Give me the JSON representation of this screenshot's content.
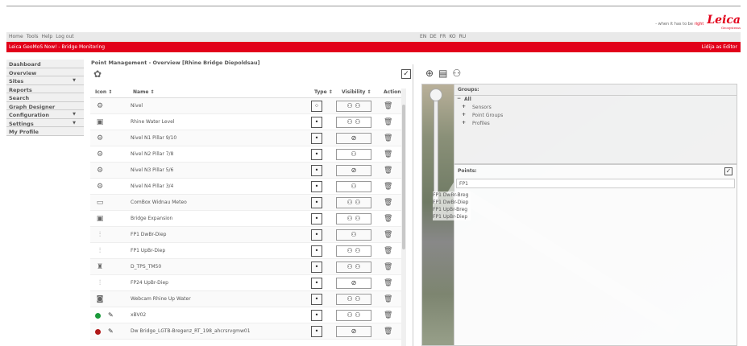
{
  "brand": {
    "tagline_prefix": "- when it has to be",
    "tagline_word": "right",
    "logo": "Leica",
    "logo_sub": "Geosystems"
  },
  "menu": {
    "items": [
      "Home",
      "Tools",
      "Help",
      "Log out"
    ],
    "languages": [
      "EN",
      "DE",
      "FR",
      "KO",
      "RU"
    ]
  },
  "app_bar": {
    "title": "Leica GeoMoS Now! - Bridge Monitoring",
    "user": "Lidija as Editor"
  },
  "sidebar": {
    "items": [
      {
        "label": "Dashboard",
        "arrow": ""
      },
      {
        "label": "Overview",
        "arrow": ""
      },
      {
        "label": "Sites",
        "arrow": "▼"
      },
      {
        "label": "Reports",
        "arrow": ""
      },
      {
        "label": "Search",
        "arrow": ""
      },
      {
        "label": "Graph Designer",
        "arrow": ""
      },
      {
        "label": "Configuration",
        "arrow": "▼"
      },
      {
        "label": "Settings",
        "arrow": "▼"
      },
      {
        "label": "My Profile",
        "arrow": ""
      }
    ]
  },
  "main": {
    "title": "Point Management - Overview [Rhine Bridge Diepoldsau]",
    "columns": {
      "icon": "Icon ⇕",
      "name": "Name ⇕",
      "type": "Type ⇕",
      "visibility": "Visibility ⇕",
      "action": "Action"
    },
    "rows": [
      {
        "icon": "gear-icon",
        "name": "Nivel",
        "type": "⁘",
        "visibility": "person-pair"
      },
      {
        "icon": "sensor-icon",
        "name": "Rhine Water Level",
        "type": "•",
        "visibility": "person-pair"
      },
      {
        "icon": "gear-icon",
        "name": "Nivel N1 Pillar 9/10",
        "type": "•",
        "visibility": "hidden"
      },
      {
        "icon": "gear-icon",
        "name": "Nivel N2 Pillar 7/8",
        "type": "•",
        "visibility": "person-single"
      },
      {
        "icon": "gear-icon",
        "name": "Nivel N3 Pillar 5/6",
        "type": "•",
        "visibility": "hidden"
      },
      {
        "icon": "gear-icon",
        "name": "Nivel N4 Pillar 3/4",
        "type": "•",
        "visibility": "person-single"
      },
      {
        "icon": "box-icon",
        "name": "ComBox Widnau Meteo",
        "type": "•",
        "visibility": "person-pair"
      },
      {
        "icon": "sensor-icon",
        "name": "Bridge Expansion",
        "type": "•",
        "visibility": "person-pair"
      },
      {
        "icon": "prism-icon",
        "name": "FP1 DwBr-Diep",
        "type": "•",
        "visibility": "person-single"
      },
      {
        "icon": "prism-icon",
        "name": "FP1 UpBr-Diep",
        "type": "•",
        "visibility": "person-pair"
      },
      {
        "icon": "total-station-icon",
        "name": "D_TPS_TM50",
        "type": "•",
        "visibility": "person-pair"
      },
      {
        "icon": "prism-icon",
        "name": "FP24 UpBr-Diep",
        "type": "•",
        "visibility": "hidden"
      },
      {
        "icon": "webcam-icon",
        "name": "Webcam Rhine Up Water",
        "type": "•",
        "visibility": "person-pair"
      },
      {
        "icon": "dot-green",
        "name": "xBV02",
        "type": "•",
        "visibility": "person-pair"
      },
      {
        "icon": "dot-red",
        "name": "Dw Bridge_LGTB-Bregenz_RT_198_ahcrsrvgmw01",
        "type": "•",
        "visibility": "hidden"
      }
    ]
  },
  "right_panel": {
    "groups": {
      "header": "Groups:",
      "all": "All",
      "items": [
        "Sensors",
        "Point Groups",
        "Profiles"
      ]
    },
    "points": {
      "header": "Points:",
      "search_value": "FP1",
      "results": [
        "FP1 DwBr-Breg",
        "FP1 DwBr-Diep",
        "FP1 UpBr-Breg",
        "FP1 UpBr-Diep"
      ]
    }
  },
  "colors": {
    "brand_red": "#e2001a"
  }
}
